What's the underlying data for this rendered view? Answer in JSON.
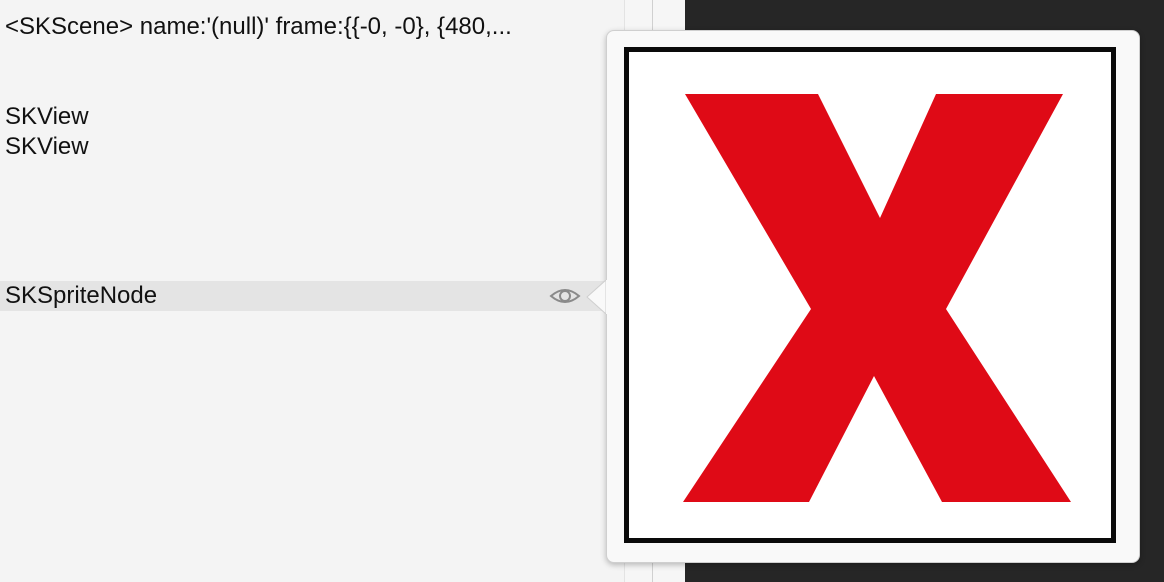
{
  "outline": {
    "items": [
      {
        "label": "<SKScene> name:'(null)' frame:{{-0, -0}, {480,..."
      },
      {
        "label": "SKView"
      },
      {
        "label": "SKView"
      },
      {
        "label": "SKSpriteNode"
      }
    ]
  },
  "preview": {
    "icon": "x-icon",
    "x_color": "#df0a16",
    "frame_color": "#0a0a0a"
  },
  "colors": {
    "background": "#f4f4f4",
    "selection": "#e4e4e4",
    "dark_panel": "#262626"
  }
}
